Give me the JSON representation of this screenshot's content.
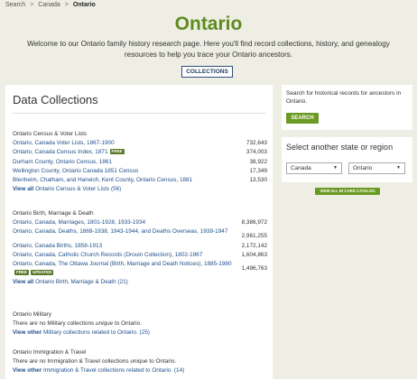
{
  "breadcrumb": {
    "items": [
      "Search",
      "Canada"
    ],
    "current": "Ontario",
    "separator": ">"
  },
  "page": {
    "title": "Ontario",
    "intro": "Welcome to our Ontario family history research page. Here you'll find record collections, history, and genealogy resources to help you trace your Ontario ancestors.",
    "collections_button": "COLLECTIONS"
  },
  "main": {
    "heading": "Data Collections",
    "sections": [
      {
        "title": "Ontario Census & Voter Lists",
        "rows": [
          {
            "name": "Ontario, Canada Voter Lists, 1867-1900",
            "count": "732,643"
          },
          {
            "name": "Ontario, Canada Census Index, 1871",
            "badge": "FREE",
            "count": "374,003"
          },
          {
            "name": "Durham County, Ontario Census, 1861",
            "count": "38,922"
          },
          {
            "name": "Wellington County, Ontario Canada 1851 Census",
            "count": "17,349"
          },
          {
            "name": "Blenheim, Chatham, and Harwich, Kent County, Ontario Census, 1881",
            "count": "13,530"
          }
        ],
        "view_all_bold": "View all",
        "view_all_rest": " Ontario Census & Voter Lists (56)"
      },
      {
        "title": "Ontario Birth, Marriage & Death",
        "rows": [
          {
            "name": "Ontario, Canada, Marriages, 1801-1928, 1933-1934",
            "count": "8,386,972"
          },
          {
            "name": "Ontario, Canada, Deaths, 1869-1938, 1943-1944, and Deaths Overseas, 1939-1947",
            "count": "2,961,255"
          },
          {
            "name": "Ontario, Canada Births, 1858-1913",
            "count": "2,172,142"
          },
          {
            "name": "Ontario, Canada, Catholic Church Records (Drouin Collection), 1802-1967",
            "count": "1,604,863"
          },
          {
            "name": "Ontario, Canada, The Ottawa Journal (Birth, Marriage and Death Notices), 1885-1980",
            "badge": "FREE",
            "badge2": "UPDATED",
            "count": "1,496,763"
          }
        ],
        "view_all_bold": "View all",
        "view_all_rest": " Ontario Birth, Marriage & Death (21)"
      },
      {
        "title": "Ontario Military",
        "none_pre": "There are no Military collections ",
        "none_em": "unique",
        "none_post": " to Ontario.",
        "view_other_bold": "View other",
        "view_other_rest": " Military collections related to Ontario. (25)"
      },
      {
        "title": "Ontario Immigration & Travel",
        "none_pre": "There are no Immigration & Travel collections ",
        "none_em": "unique",
        "none_post": " to Ontario.",
        "view_other_bold": "View other",
        "view_other_rest": " Immigration & Travel collections related to Ontario. (14)"
      }
    ]
  },
  "sidebar": {
    "search_text": "Search for historical records for ancestors in Ontario.",
    "search_button": "SEARCH",
    "state_heading": "Select another state or region",
    "country_select": "Canada",
    "region_select": "Ontario",
    "catalog_button": "VIEW ALL IN CARD CATALOG"
  },
  "colors": {
    "brand_green": "#5e8b1f",
    "button_green": "#6b9a24",
    "link_blue": "#1f4f8b",
    "background": "#eeeee4"
  }
}
